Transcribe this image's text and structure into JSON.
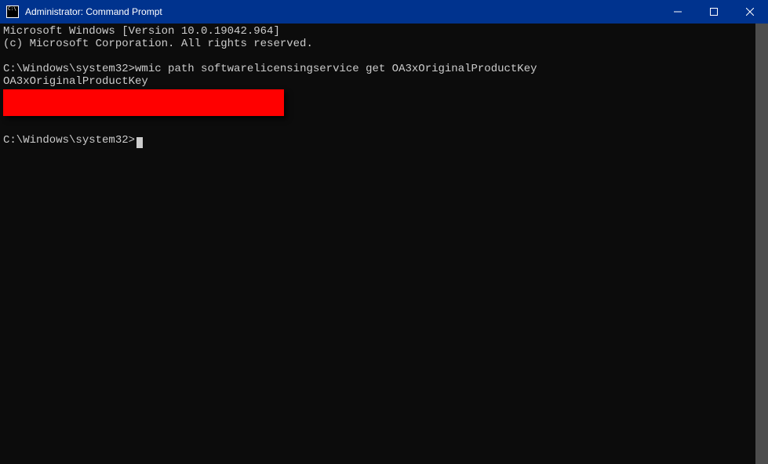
{
  "window": {
    "title": "Administrator: Command Prompt"
  },
  "terminal": {
    "line1": "Microsoft Windows [Version 10.0.19042.964]",
    "line2": "(c) Microsoft Corporation. All rights reserved.",
    "blank1": "",
    "prompt1": "C:\\Windows\\system32>",
    "command1": "wmic path softwarelicensingservice get OA3xOriginalProductKey",
    "output_header": "OA3xOriginalProductKey",
    "blank2": "",
    "prompt2": "C:\\Windows\\system32>",
    "cursor": "_"
  }
}
